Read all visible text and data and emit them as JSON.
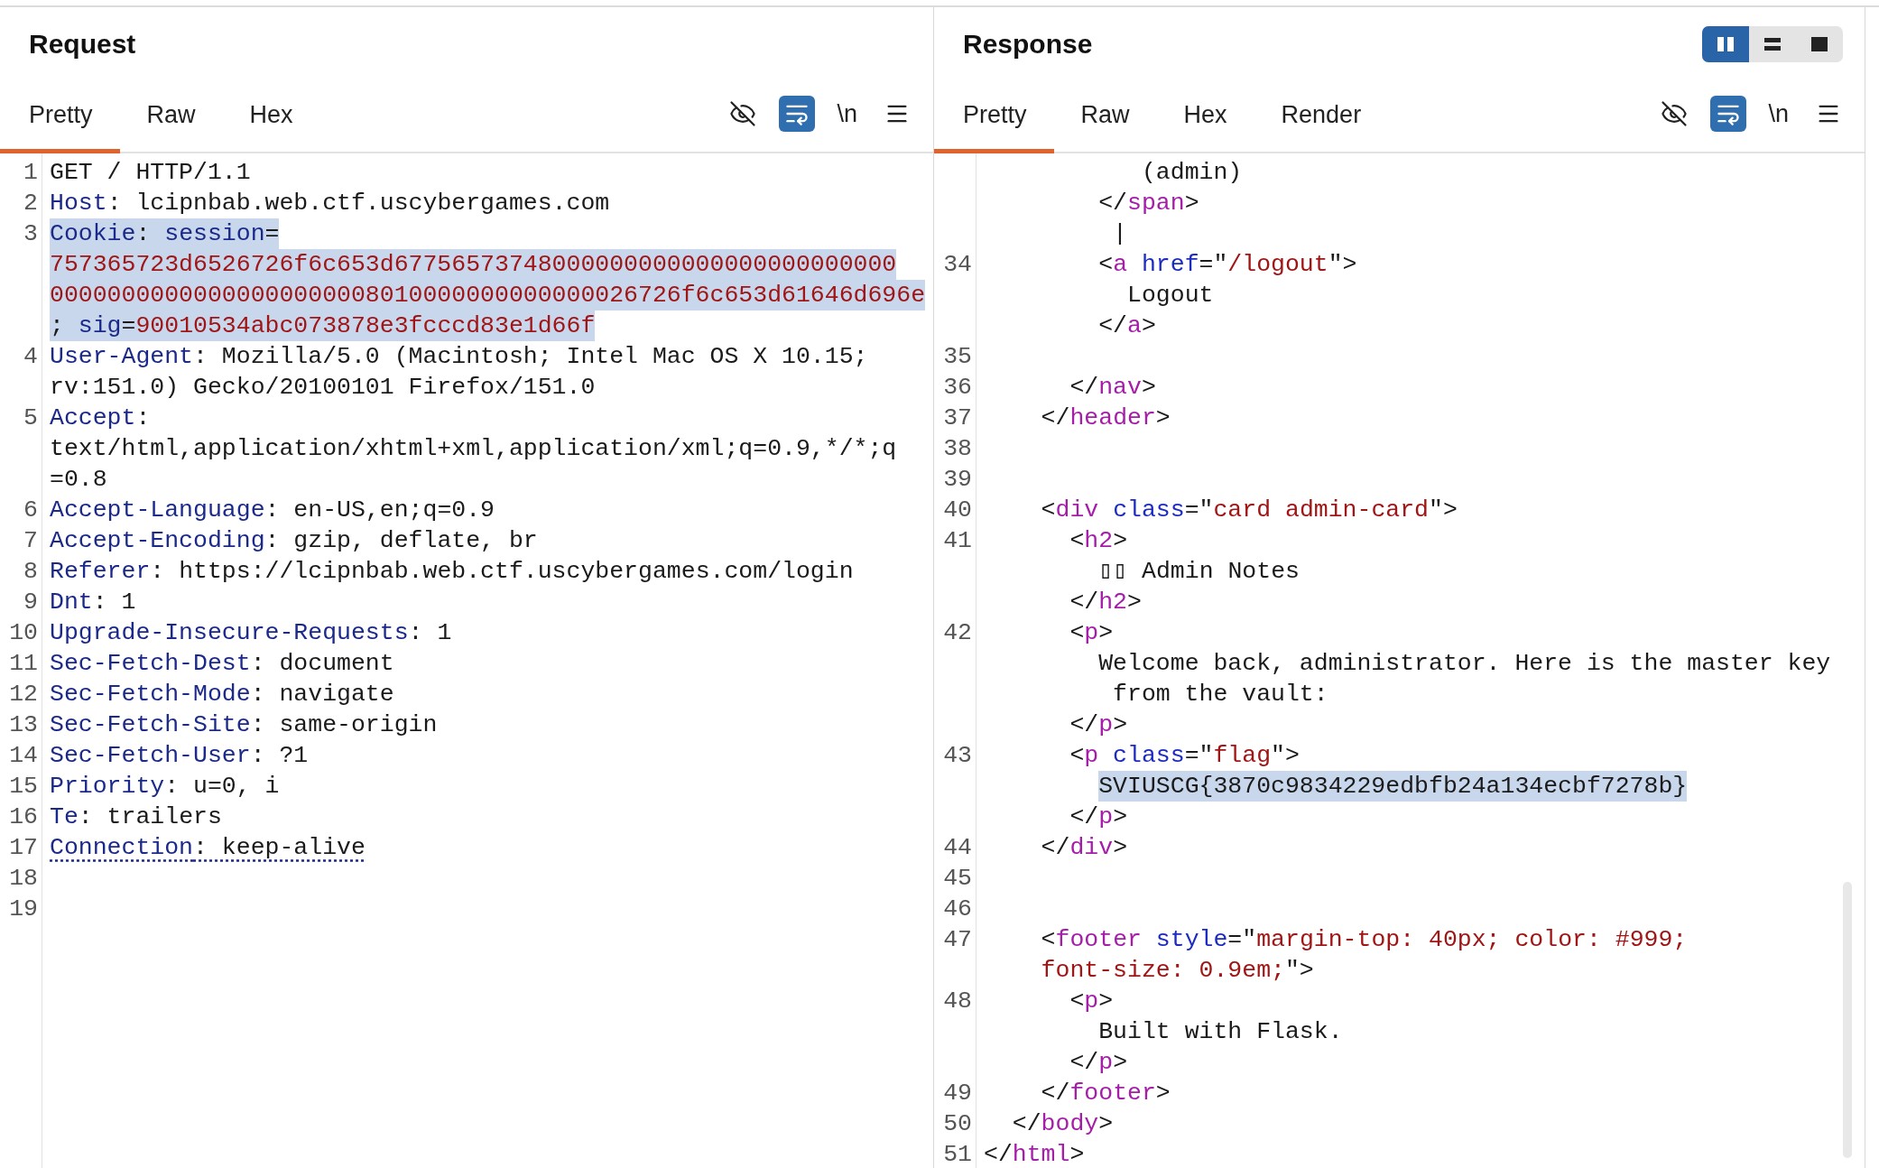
{
  "request": {
    "title": "Request",
    "tabs": [
      {
        "label": "Pretty",
        "selected": true
      },
      {
        "label": "Raw",
        "selected": false
      },
      {
        "label": "Hex",
        "selected": false
      }
    ],
    "toolbar": {
      "wrap_on": true,
      "newline_label": "\\n"
    },
    "lines": [
      {
        "number": "1",
        "rows": [
          {
            "kind": "normal",
            "tokens": [
              {
                "kind": "plain",
                "text": "GET / HTTP/1.1"
              }
            ]
          }
        ]
      },
      {
        "number": "2",
        "rows": [
          {
            "kind": "normal",
            "tokens": [
              {
                "kind": "name",
                "text": "Host"
              },
              {
                "kind": "plain",
                "text": ": lcipnbab.web.ctf.uscybergames.com"
              }
            ]
          }
        ]
      },
      {
        "number": "3",
        "rows": [
          {
            "kind": "selected",
            "tokens": [
              {
                "kind": "name",
                "text": "Cookie"
              },
              {
                "kind": "plain",
                "text": ": "
              },
              {
                "kind": "name",
                "text": "session"
              },
              {
                "kind": "plain",
                "text": "="
              }
            ]
          },
          {
            "kind": "selected",
            "tokens": [
              {
                "kind": "value",
                "text": "757365723d6526726f6c653d67756573748000000000000000000000000"
              }
            ]
          },
          {
            "kind": "selected",
            "tokens": [
              {
                "kind": "value",
                "text": "00000000000000000000008010000000000000026726f6c653d61646d696e"
              }
            ]
          },
          {
            "kind": "selected",
            "tokens": [
              {
                "kind": "plain",
                "text": "; "
              },
              {
                "kind": "name",
                "text": "sig"
              },
              {
                "kind": "plain",
                "text": "="
              },
              {
                "kind": "value",
                "text": "90010534abc073878e3fcccd83e1d66f"
              }
            ]
          }
        ]
      },
      {
        "number": "4",
        "rows": [
          {
            "kind": "normal",
            "tokens": [
              {
                "kind": "name",
                "text": "User-Agent"
              },
              {
                "kind": "plain",
                "text": ": Mozilla/5.0 (Macintosh; Intel Mac OS X 10.15;"
              }
            ]
          },
          {
            "kind": "normal",
            "tokens": [
              {
                "kind": "plain",
                "text": "rv:151.0) Gecko/20100101 Firefox/151.0"
              }
            ]
          }
        ]
      },
      {
        "number": "5",
        "rows": [
          {
            "kind": "normal",
            "tokens": [
              {
                "kind": "name",
                "text": "Accept"
              },
              {
                "kind": "plain",
                "text": ":"
              }
            ]
          },
          {
            "kind": "normal",
            "tokens": [
              {
                "kind": "plain",
                "text": "text/html,application/xhtml+xml,application/xml;q=0.9,*/*;q"
              }
            ]
          },
          {
            "kind": "normal",
            "tokens": [
              {
                "kind": "plain",
                "text": "=0.8"
              }
            ]
          }
        ]
      },
      {
        "number": "6",
        "rows": [
          {
            "kind": "normal",
            "tokens": [
              {
                "kind": "name",
                "text": "Accept-Language"
              },
              {
                "kind": "plain",
                "text": ": en-US,en;q=0.9"
              }
            ]
          }
        ]
      },
      {
        "number": "7",
        "rows": [
          {
            "kind": "normal",
            "tokens": [
              {
                "kind": "name",
                "text": "Accept-Encoding"
              },
              {
                "kind": "plain",
                "text": ": gzip, deflate, br"
              }
            ]
          }
        ]
      },
      {
        "number": "8",
        "rows": [
          {
            "kind": "normal",
            "tokens": [
              {
                "kind": "name",
                "text": "Referer"
              },
              {
                "kind": "plain",
                "text": ": https://lcipnbab.web.ctf.uscybergames.com/login"
              }
            ]
          }
        ]
      },
      {
        "number": "9",
        "rows": [
          {
            "kind": "normal",
            "tokens": [
              {
                "kind": "name",
                "text": "Dnt"
              },
              {
                "kind": "plain",
                "text": ": 1"
              }
            ]
          }
        ]
      },
      {
        "number": "10",
        "rows": [
          {
            "kind": "normal",
            "tokens": [
              {
                "kind": "name",
                "text": "Upgrade-Insecure-Requests"
              },
              {
                "kind": "plain",
                "text": ": 1"
              }
            ]
          }
        ]
      },
      {
        "number": "11",
        "rows": [
          {
            "kind": "normal",
            "tokens": [
              {
                "kind": "name",
                "text": "Sec-Fetch-Dest"
              },
              {
                "kind": "plain",
                "text": ": document"
              }
            ]
          }
        ]
      },
      {
        "number": "12",
        "rows": [
          {
            "kind": "normal",
            "tokens": [
              {
                "kind": "name",
                "text": "Sec-Fetch-Mode"
              },
              {
                "kind": "plain",
                "text": ": navigate"
              }
            ]
          }
        ]
      },
      {
        "number": "13",
        "rows": [
          {
            "kind": "normal",
            "tokens": [
              {
                "kind": "name",
                "text": "Sec-Fetch-Site"
              },
              {
                "kind": "plain",
                "text": ": same-origin"
              }
            ]
          }
        ]
      },
      {
        "number": "14",
        "rows": [
          {
            "kind": "normal",
            "tokens": [
              {
                "kind": "name",
                "text": "Sec-Fetch-User"
              },
              {
                "kind": "plain",
                "text": ": ?1"
              }
            ]
          }
        ]
      },
      {
        "number": "15",
        "rows": [
          {
            "kind": "normal",
            "tokens": [
              {
                "kind": "name",
                "text": "Priority"
              },
              {
                "kind": "plain",
                "text": ": u=0, i"
              }
            ]
          }
        ]
      },
      {
        "number": "16",
        "rows": [
          {
            "kind": "normal",
            "tokens": [
              {
                "kind": "name",
                "text": "Te"
              },
              {
                "kind": "plain",
                "text": ": trailers"
              }
            ]
          }
        ]
      },
      {
        "number": "17",
        "rows": [
          {
            "kind": "underlined",
            "tokens": [
              {
                "kind": "name",
                "text": "Connection"
              },
              {
                "kind": "plain",
                "text": ": keep-alive"
              }
            ]
          }
        ]
      },
      {
        "number": "18"
      },
      {
        "number": "19"
      }
    ]
  },
  "response": {
    "title": "Response",
    "layout_buttons": [
      {
        "kind": "columns",
        "selected": true
      },
      {
        "kind": "rows",
        "selected": false
      },
      {
        "kind": "single",
        "selected": false
      }
    ],
    "tabs": [
      {
        "label": "Pretty",
        "selected": true
      },
      {
        "label": "Raw",
        "selected": false
      },
      {
        "label": "Hex",
        "selected": false
      },
      {
        "label": "Render",
        "selected": false
      }
    ],
    "toolbar": {
      "wrap_on": true,
      "newline_label": "\\n"
    },
    "lines": [
      {
        "rows": [
          {
            "kind": "normal",
            "tokens": [
              {
                "kind": "plain",
                "text": "           (admin)"
              }
            ]
          },
          {
            "kind": "normal",
            "tokens": [
              {
                "kind": "plain",
                "text": "        </"
              },
              {
                "kind": "tag",
                "text": "span"
              },
              {
                "kind": "plain",
                "text": ">"
              }
            ]
          },
          {
            "kind": "normal",
            "tokens": [
              {
                "kind": "plain",
                "text": "         |"
              }
            ]
          }
        ]
      },
      {
        "number": "34",
        "rows": [
          {
            "kind": "normal",
            "tokens": [
              {
                "kind": "plain",
                "text": "        <"
              },
              {
                "kind": "tag",
                "text": "a"
              },
              {
                "kind": "attr",
                "text": " href"
              },
              {
                "kind": "plain",
                "text": "=\""
              },
              {
                "kind": "string",
                "text": "/logout"
              },
              {
                "kind": "plain",
                "text": "\">"
              }
            ]
          },
          {
            "kind": "normal",
            "tokens": [
              {
                "kind": "plain",
                "text": "          Logout"
              }
            ]
          },
          {
            "kind": "normal",
            "tokens": [
              {
                "kind": "plain",
                "text": "        </"
              },
              {
                "kind": "tag",
                "text": "a"
              },
              {
                "kind": "plain",
                "text": ">"
              }
            ]
          }
        ]
      },
      {
        "number": "35"
      },
      {
        "number": "36",
        "rows": [
          {
            "kind": "normal",
            "tokens": [
              {
                "kind": "plain",
                "text": "      </"
              },
              {
                "kind": "tag",
                "text": "nav"
              },
              {
                "kind": "plain",
                "text": ">"
              }
            ]
          }
        ]
      },
      {
        "number": "37",
        "rows": [
          {
            "kind": "normal",
            "tokens": [
              {
                "kind": "plain",
                "text": "    </"
              },
              {
                "kind": "tag",
                "text": "header"
              },
              {
                "kind": "plain",
                "text": ">"
              }
            ]
          }
        ]
      },
      {
        "number": "38"
      },
      {
        "number": "39"
      },
      {
        "number": "40",
        "rows": [
          {
            "kind": "normal",
            "tokens": [
              {
                "kind": "plain",
                "text": "    <"
              },
              {
                "kind": "tag",
                "text": "div"
              },
              {
                "kind": "attr",
                "text": " class"
              },
              {
                "kind": "plain",
                "text": "=\""
              },
              {
                "kind": "string",
                "text": "card admin-card"
              },
              {
                "kind": "plain",
                "text": "\">"
              }
            ]
          }
        ]
      },
      {
        "number": "41",
        "rows": [
          {
            "kind": "normal",
            "tokens": [
              {
                "kind": "plain",
                "text": "      <"
              },
              {
                "kind": "tag",
                "text": "h2"
              },
              {
                "kind": "plain",
                "text": ">"
              }
            ]
          },
          {
            "kind": "normal",
            "tokens": [
              {
                "kind": "plain",
                "text": "        ▯▯ Admin Notes"
              }
            ]
          },
          {
            "kind": "normal",
            "tokens": [
              {
                "kind": "plain",
                "text": "      </"
              },
              {
                "kind": "tag",
                "text": "h2"
              },
              {
                "kind": "plain",
                "text": ">"
              }
            ]
          }
        ]
      },
      {
        "number": "42",
        "rows": [
          {
            "kind": "normal",
            "tokens": [
              {
                "kind": "plain",
                "text": "      <"
              },
              {
                "kind": "tag",
                "text": "p"
              },
              {
                "kind": "plain",
                "text": ">"
              }
            ]
          },
          {
            "kind": "normal",
            "tokens": [
              {
                "kind": "plain",
                "text": "        Welcome back, administrator. Here is the master key"
              }
            ]
          },
          {
            "kind": "normal",
            "tokens": [
              {
                "kind": "plain",
                "text": "         from the vault:"
              }
            ]
          },
          {
            "kind": "normal",
            "tokens": [
              {
                "kind": "plain",
                "text": "      </"
              },
              {
                "kind": "tag",
                "text": "p"
              },
              {
                "kind": "plain",
                "text": ">"
              }
            ]
          }
        ]
      },
      {
        "number": "43",
        "rows": [
          {
            "kind": "normal",
            "tokens": [
              {
                "kind": "plain",
                "text": "      <"
              },
              {
                "kind": "tag",
                "text": "p"
              },
              {
                "kind": "attr",
                "text": " class"
              },
              {
                "kind": "plain",
                "text": "=\""
              },
              {
                "kind": "string",
                "text": "flag"
              },
              {
                "kind": "plain",
                "text": "\">"
              }
            ]
          },
          {
            "kind": "selected",
            "tokens": [
              {
                "kind": "plain",
                "text": "        SVIUSCG{3870c9834229edbfb24a134ecbf7278b}"
              }
            ]
          },
          {
            "kind": "normal",
            "tokens": [
              {
                "kind": "plain",
                "text": "      </"
              },
              {
                "kind": "tag",
                "text": "p"
              },
              {
                "kind": "plain",
                "text": ">"
              }
            ]
          }
        ]
      },
      {
        "number": "44",
        "rows": [
          {
            "kind": "normal",
            "tokens": [
              {
                "kind": "plain",
                "text": "    </"
              },
              {
                "kind": "tag",
                "text": "div"
              },
              {
                "kind": "plain",
                "text": ">"
              }
            ]
          }
        ]
      },
      {
        "number": "45"
      },
      {
        "number": "46"
      },
      {
        "number": "47",
        "rows": [
          {
            "kind": "normal",
            "tokens": [
              {
                "kind": "plain",
                "text": "    <"
              },
              {
                "kind": "tag",
                "text": "footer"
              },
              {
                "kind": "attr",
                "text": " style"
              },
              {
                "kind": "plain",
                "text": "=\""
              },
              {
                "kind": "string",
                "text": "margin-top: 40px; color: #999;"
              }
            ]
          },
          {
            "kind": "normal",
            "tokens": [
              {
                "kind": "string",
                "text": "    font-size: 0.9em;"
              },
              {
                "kind": "plain",
                "text": "\">"
              }
            ]
          }
        ]
      },
      {
        "number": "48",
        "rows": [
          {
            "kind": "normal",
            "tokens": [
              {
                "kind": "plain",
                "text": "      <"
              },
              {
                "kind": "tag",
                "text": "p"
              },
              {
                "kind": "plain",
                "text": ">"
              }
            ]
          },
          {
            "kind": "normal",
            "tokens": [
              {
                "kind": "plain",
                "text": "        Built with Flask."
              }
            ]
          },
          {
            "kind": "normal",
            "tokens": [
              {
                "kind": "plain",
                "text": "      </"
              },
              {
                "kind": "tag",
                "text": "p"
              },
              {
                "kind": "plain",
                "text": ">"
              }
            ]
          }
        ]
      },
      {
        "number": "49",
        "rows": [
          {
            "kind": "normal",
            "tokens": [
              {
                "kind": "plain",
                "text": "    </"
              },
              {
                "kind": "tag",
                "text": "footer"
              },
              {
                "kind": "plain",
                "text": ">"
              }
            ]
          }
        ]
      },
      {
        "number": "50",
        "rows": [
          {
            "kind": "normal",
            "tokens": [
              {
                "kind": "plain",
                "text": "  </"
              },
              {
                "kind": "tag",
                "text": "body"
              },
              {
                "kind": "plain",
                "text": ">"
              }
            ]
          }
        ]
      },
      {
        "number": "51",
        "rows": [
          {
            "kind": "normal",
            "tokens": [
              {
                "kind": "plain",
                "text": "</"
              },
              {
                "kind": "tag",
                "text": "html"
              },
              {
                "kind": "plain",
                "text": ">"
              }
            ]
          }
        ]
      }
    ]
  }
}
